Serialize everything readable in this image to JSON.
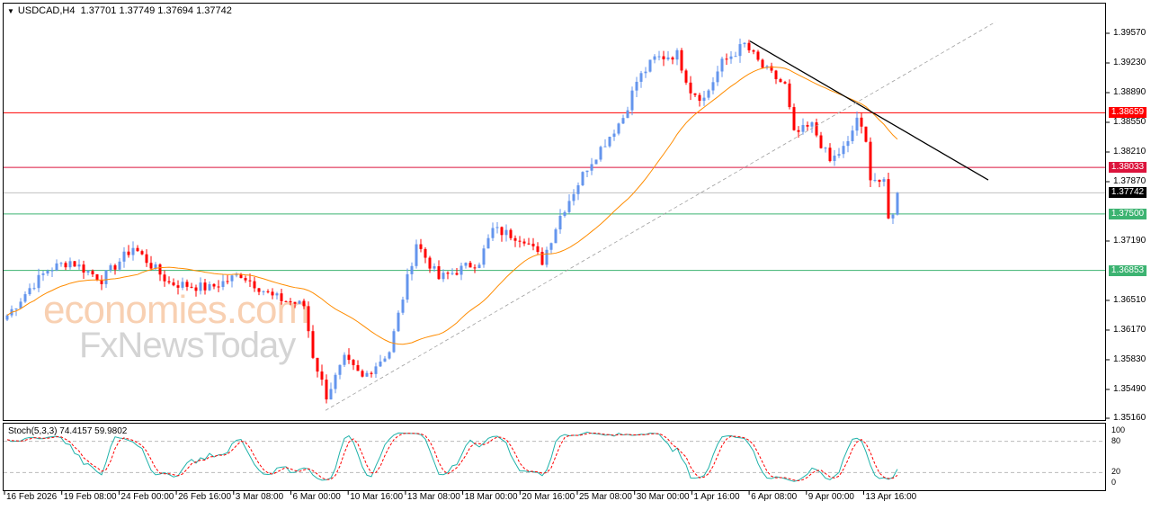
{
  "header": {
    "symbol": "USDCAD,H4",
    "open": "1.37701",
    "high": "1.37749",
    "low": "1.37694",
    "close": "1.37742"
  },
  "price_axis": {
    "ticks": [
      "1.39570",
      "1.39230",
      "1.38890",
      "1.38550",
      "1.38210",
      "1.37870",
      "1.37190",
      "1.36510",
      "1.36170",
      "1.35830",
      "1.35490",
      "1.35160"
    ],
    "range": [
      1.3516,
      1.3957
    ]
  },
  "levels": [
    {
      "label": "1.38659",
      "price": 1.38659,
      "color": "#ff0000"
    },
    {
      "label": "1.38033",
      "price": 1.38033,
      "color": "#dc143c"
    },
    {
      "label": "1.37742",
      "price": 1.37742,
      "color": "#000000",
      "line": "#c0c0c0"
    },
    {
      "label": "1.37500",
      "price": 1.375,
      "color": "#3cb371"
    },
    {
      "label": "1.36853",
      "price": 1.36853,
      "color": "#3cb371"
    }
  ],
  "colors": {
    "bull": "#6495ed",
    "bear": "#ff0000",
    "ma": "#ff8c00",
    "stoch_main": "#20b2aa",
    "stoch_signal": "#ff0000"
  },
  "chart_data": {
    "type": "candlestick",
    "candles": 199,
    "waypoints": [
      [
        0,
        1.3634
      ],
      [
        5,
        1.3665
      ],
      [
        9,
        1.3686
      ],
      [
        14,
        1.3696
      ],
      [
        21,
        1.3675
      ],
      [
        28,
        1.3712
      ],
      [
        36,
        1.3671
      ],
      [
        45,
        1.3665
      ],
      [
        52,
        1.3681
      ],
      [
        59,
        1.3655
      ],
      [
        66,
        1.3645
      ],
      [
        68,
        1.3588
      ],
      [
        71,
        1.3542
      ],
      [
        75,
        1.3583
      ],
      [
        79,
        1.3562
      ],
      [
        85,
        1.3593
      ],
      [
        87,
        1.3634
      ],
      [
        91,
        1.3717
      ],
      [
        96,
        1.3676
      ],
      [
        105,
        1.3696
      ],
      [
        108,
        1.3732
      ],
      [
        115,
        1.3722
      ],
      [
        119,
        1.3696
      ],
      [
        123,
        1.3748
      ],
      [
        129,
        1.3804
      ],
      [
        137,
        1.3861
      ],
      [
        140,
        1.3902
      ],
      [
        144,
        1.3928
      ],
      [
        149,
        1.3933
      ],
      [
        152,
        1.3892
      ],
      [
        155,
        1.3882
      ],
      [
        159,
        1.3923
      ],
      [
        164,
        1.3944
      ],
      [
        168,
        1.3918
      ],
      [
        173,
        1.3897
      ],
      [
        175,
        1.3841
      ],
      [
        179,
        1.3851
      ],
      [
        183,
        1.381
      ],
      [
        187,
        1.383
      ],
      [
        189,
        1.3861
      ],
      [
        191,
        1.383
      ],
      [
        192,
        1.3794
      ],
      [
        195,
        1.3784
      ],
      [
        196,
        1.3743
      ],
      [
        199,
        1.3774
      ]
    ],
    "trendlines": [
      {
        "from": [
          165.2,
          1.3948
        ],
        "to": [
          218.2,
          1.3789
        ],
        "color": "#000000",
        "style": "solid"
      },
      {
        "from": [
          70.8,
          1.3525
        ],
        "to": [
          219.8,
          1.397
        ],
        "color": "#a0a0a0",
        "style": "dashed"
      }
    ]
  },
  "stoch": {
    "label": "Stoch(5,3,3) 74.4157 59.9802",
    "levels": [
      "100",
      "80",
      "20",
      "0"
    ]
  },
  "x_axis": [
    "16 Feb 2026",
    "19 Feb 08:00",
    "24 Feb 00:00",
    "26 Feb 16:00",
    "3 Mar 08:00",
    "6 Mar 00:00",
    "10 Mar 16:00",
    "13 Mar 08:00",
    "18 Mar 00:00",
    "20 Mar 16:00",
    "25 Mar 08:00",
    "30 Mar 00:00",
    "1 Apr 16:00",
    "6 Apr 08:00",
    "9 Apr 00:00",
    "13 Apr 16:00"
  ],
  "watermark": {
    "line1": "economies.com",
    "line2": "FxNewsToday"
  }
}
